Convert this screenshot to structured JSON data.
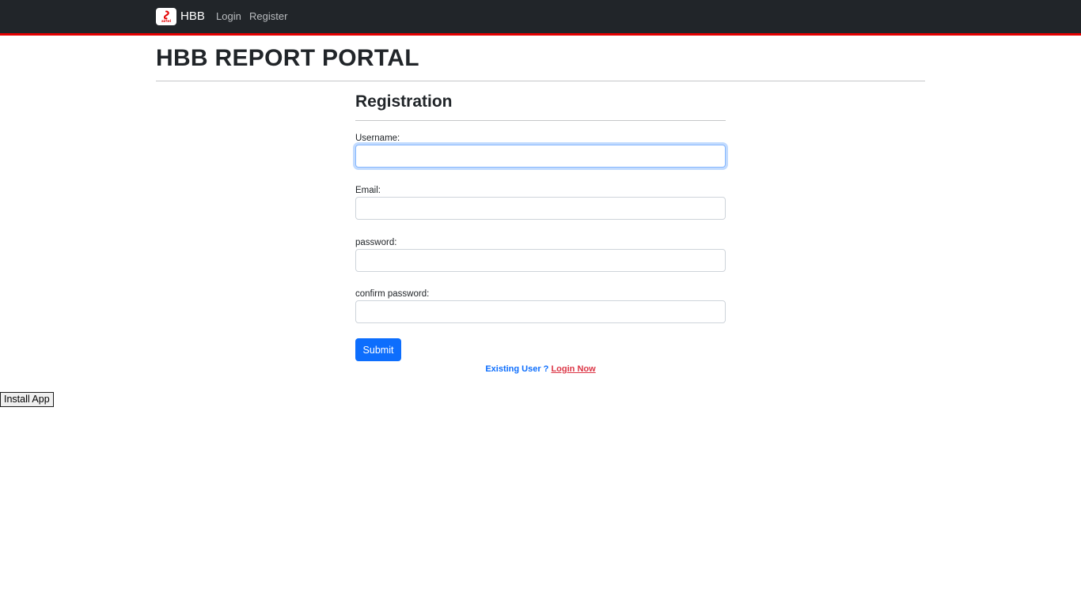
{
  "navbar": {
    "brand": {
      "logo_text": "airtel",
      "name": "HBB"
    },
    "links": [
      {
        "label": "Login"
      },
      {
        "label": "Register"
      }
    ],
    "accent_color": "#e40000"
  },
  "page": {
    "title": "HBB REPORT PORTAL"
  },
  "form": {
    "heading": "Registration",
    "fields": [
      {
        "label": "Username:",
        "value": "",
        "focused": true
      },
      {
        "label": "Email:",
        "value": ""
      },
      {
        "label": "password:",
        "value": ""
      },
      {
        "label": "confirm password:",
        "value": ""
      }
    ],
    "submit_label": "Submit",
    "existing_user_text": "Existing User ?",
    "login_now_label": "Login Now"
  },
  "install_app_label": "Install App",
  "colors": {
    "primary": "#0d6efd",
    "danger": "#dc3545",
    "navbar": "#212529"
  }
}
